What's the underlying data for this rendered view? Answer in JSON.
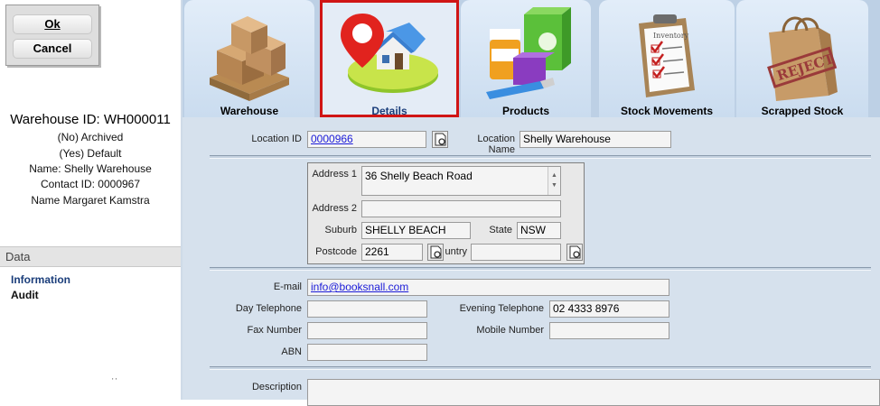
{
  "dialog": {
    "ok_label": "Ok",
    "cancel_label": "Cancel"
  },
  "summary": {
    "title": "Warehouse ID: WH000011",
    "archived": "(No) Archived",
    "default": "(Yes) Default",
    "name": "Name: Shelly Warehouse",
    "contact_id": "Contact ID: 0000967",
    "contact_name": "Name Margaret Kamstra"
  },
  "data_panel": {
    "heading": "Data",
    "items": [
      "Information",
      "Audit"
    ]
  },
  "footer_text": "' '",
  "tabs": [
    {
      "label": "Warehouse",
      "icon": "pallet-boxes-icon"
    },
    {
      "label": "Details",
      "icon": "location-house-icon",
      "selected": true
    },
    {
      "label": "Products",
      "icon": "products-icon"
    },
    {
      "label": "Stock Movements",
      "icon": "inventory-clipboard-icon"
    },
    {
      "label": "Scrapped Stock",
      "icon": "reject-bag-icon"
    }
  ],
  "form": {
    "location_id_label": "Location ID",
    "location_id": "0000966",
    "location_name_label": "Location Name",
    "location_name": "Shelly Warehouse",
    "address1_label": "Address 1",
    "address1": "36 Shelly Beach Road",
    "address2_label": "Address 2",
    "address2": "",
    "suburb_label": "Suburb",
    "suburb": "SHELLY BEACH",
    "state_label": "State",
    "state": "NSW",
    "postcode_label": "Postcode",
    "postcode": "2261",
    "country_label": "untry",
    "country": "",
    "email_label": "E-mail",
    "email": "info@booksnall.com",
    "day_tel_label": "Day Telephone",
    "day_tel": "",
    "evening_tel_label": "Evening Telephone",
    "evening_tel": "02 4333 8976",
    "fax_label": "Fax Number",
    "fax": "",
    "mobile_label": "Mobile Number",
    "mobile": "",
    "abn_label": "ABN",
    "abn": "",
    "description_label": "Description",
    "description": ""
  },
  "colors": {
    "selected_border": "#d01515",
    "link": "#1b1bd8",
    "panel_bg": "#d6e1ed"
  }
}
